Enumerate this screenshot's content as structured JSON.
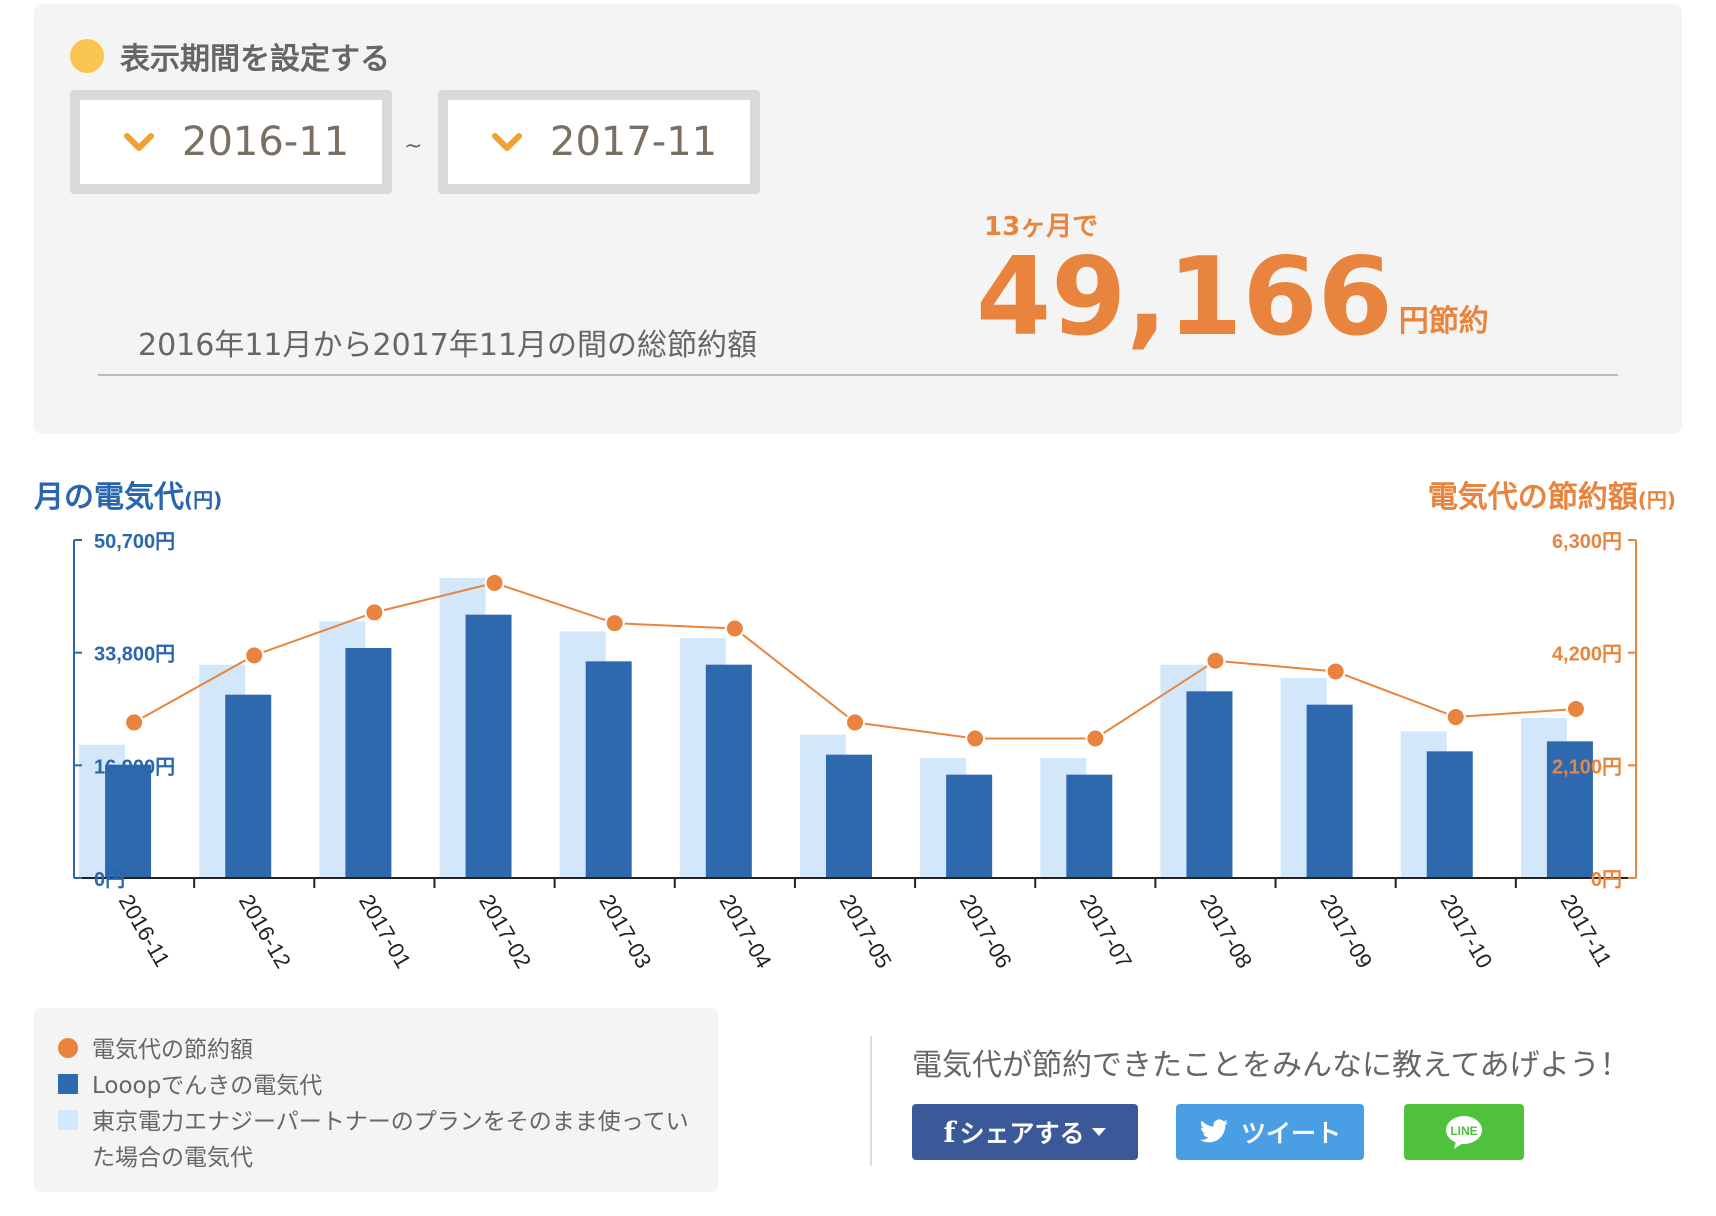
{
  "period": {
    "title": "表示期間を設定する",
    "from": "2016-11",
    "to": "2017-11",
    "separator": "~"
  },
  "summary": {
    "months_label": "13ヶ月で",
    "amount": "49,166",
    "amount_unit": "円節約",
    "description": "2016年11月から2017年11月の間の総節約額"
  },
  "axes": {
    "left_title": "月の電気代",
    "left_unit": "(円)",
    "right_title": "電気代の節約額",
    "right_unit": "(円)"
  },
  "chart_data": {
    "type": "bar",
    "categories": [
      "2016-11",
      "2016-12",
      "2017-01",
      "2017-02",
      "2017-03",
      "2017-04",
      "2017-05",
      "2017-06",
      "2017-07",
      "2017-08",
      "2017-09",
      "2017-10",
      "2017-11"
    ],
    "series": [
      {
        "name": "東京電力エナジーパートナーのプランをそのまま使っていた場合の電気代",
        "axis": "left",
        "kind": "bar",
        "values": [
          20000,
          32000,
          38500,
          45000,
          37000,
          36000,
          21500,
          18000,
          18000,
          32000,
          30000,
          22000,
          24000
        ]
      },
      {
        "name": "Looopでんきの電気代",
        "axis": "left",
        "kind": "bar",
        "values": [
          17000,
          27500,
          34500,
          39500,
          32500,
          32000,
          18500,
          15500,
          15500,
          28000,
          26000,
          19000,
          20500
        ]
      },
      {
        "name": "電気代の節約額",
        "axis": "right",
        "kind": "line",
        "values": [
          2900,
          4150,
          4950,
          5500,
          4750,
          4650,
          2900,
          2600,
          2600,
          4050,
          3850,
          3000,
          3150
        ]
      }
    ],
    "y_left": {
      "ticks": [
        "0円",
        "16,900円",
        "33,800円",
        "50,700円"
      ],
      "ylim": [
        0,
        50700
      ]
    },
    "y_right": {
      "ticks": [
        "0円",
        "2,100円",
        "4,200円",
        "6,300円"
      ],
      "ylim": [
        0,
        6300
      ]
    },
    "colors": {
      "line": "#e8843d",
      "bar_tepco": "#d3e7fb",
      "bar_looop": "#2e69ae",
      "axis_left": "#2a66ad",
      "axis_right": "#e8843d"
    }
  },
  "legend": {
    "items": [
      {
        "label": "電気代の節約額",
        "color": "#e8843d",
        "shape": "circle"
      },
      {
        "label": "Looopでんきの電気代",
        "color": "#2e69ae",
        "shape": "square"
      },
      {
        "label": "東京電力エナジーパートナーのプランをそのまま使っていた場合の電気代",
        "color": "#d3e7fb",
        "shape": "square"
      }
    ]
  },
  "share": {
    "text": "電気代が節約できたことをみんなに教えてあげよう！",
    "facebook_label": "シェアする",
    "twitter_label": "ツイート",
    "line_label": "LINE"
  }
}
